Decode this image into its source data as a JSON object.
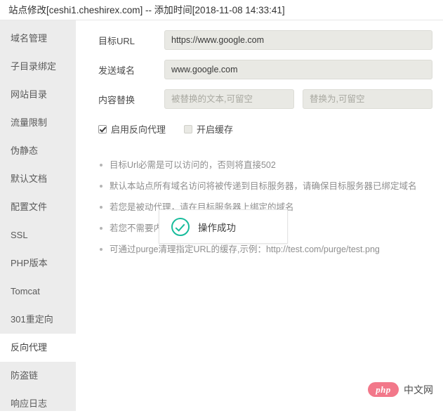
{
  "window": {
    "title": "站点修改[ceshi1.cheshirex.com] -- 添加时间[2018-11-08 14:33:41]"
  },
  "sidebar": {
    "items": [
      {
        "label": "域名管理",
        "active": false
      },
      {
        "label": "子目录绑定",
        "active": false
      },
      {
        "label": "网站目录",
        "active": false
      },
      {
        "label": "流量限制",
        "active": false
      },
      {
        "label": "伪静态",
        "active": false
      },
      {
        "label": "默认文档",
        "active": false
      },
      {
        "label": "配置文件",
        "active": false
      },
      {
        "label": "SSL",
        "active": false
      },
      {
        "label": "PHP版本",
        "active": false
      },
      {
        "label": "Tomcat",
        "active": false
      },
      {
        "label": "301重定向",
        "active": false
      },
      {
        "label": "反向代理",
        "active": true
      },
      {
        "label": "防盗链",
        "active": false
      },
      {
        "label": "响应日志",
        "active": false
      }
    ]
  },
  "form": {
    "target_url": {
      "label": "目标URL",
      "value": "https://www.google.com",
      "placeholder": ""
    },
    "send_domain": {
      "label": "发送域名",
      "value": "www.google.com",
      "placeholder": ""
    },
    "content_replace": {
      "label": "内容替换",
      "from_value": "",
      "from_placeholder": "被替换的文本,可留空",
      "to_value": "",
      "to_placeholder": "替换为,可留空"
    }
  },
  "checkboxes": {
    "enable_proxy": {
      "label": "启用反向代理",
      "checked": true
    },
    "enable_cache": {
      "label": "开启缓存",
      "checked": false
    }
  },
  "tips": [
    "目标Url必需是可以访问的，否则将直接502",
    "默认本站点所有域名访问将被传递到目标服务器，请确保目标服务器已绑定域名",
    "若您是被动代理，请在目标服务器上绑定的域名",
    "若您不需要内容替换，请留空",
    "可通过purge清理指定URL的缓存,示例：http://test.com/purge/test.png"
  ],
  "toast": {
    "message": "操作成功",
    "icon_color": "#18bc9c"
  },
  "watermark": {
    "logo_text": "php",
    "site_text": "中文网",
    "logo_color": "#f2788a"
  }
}
